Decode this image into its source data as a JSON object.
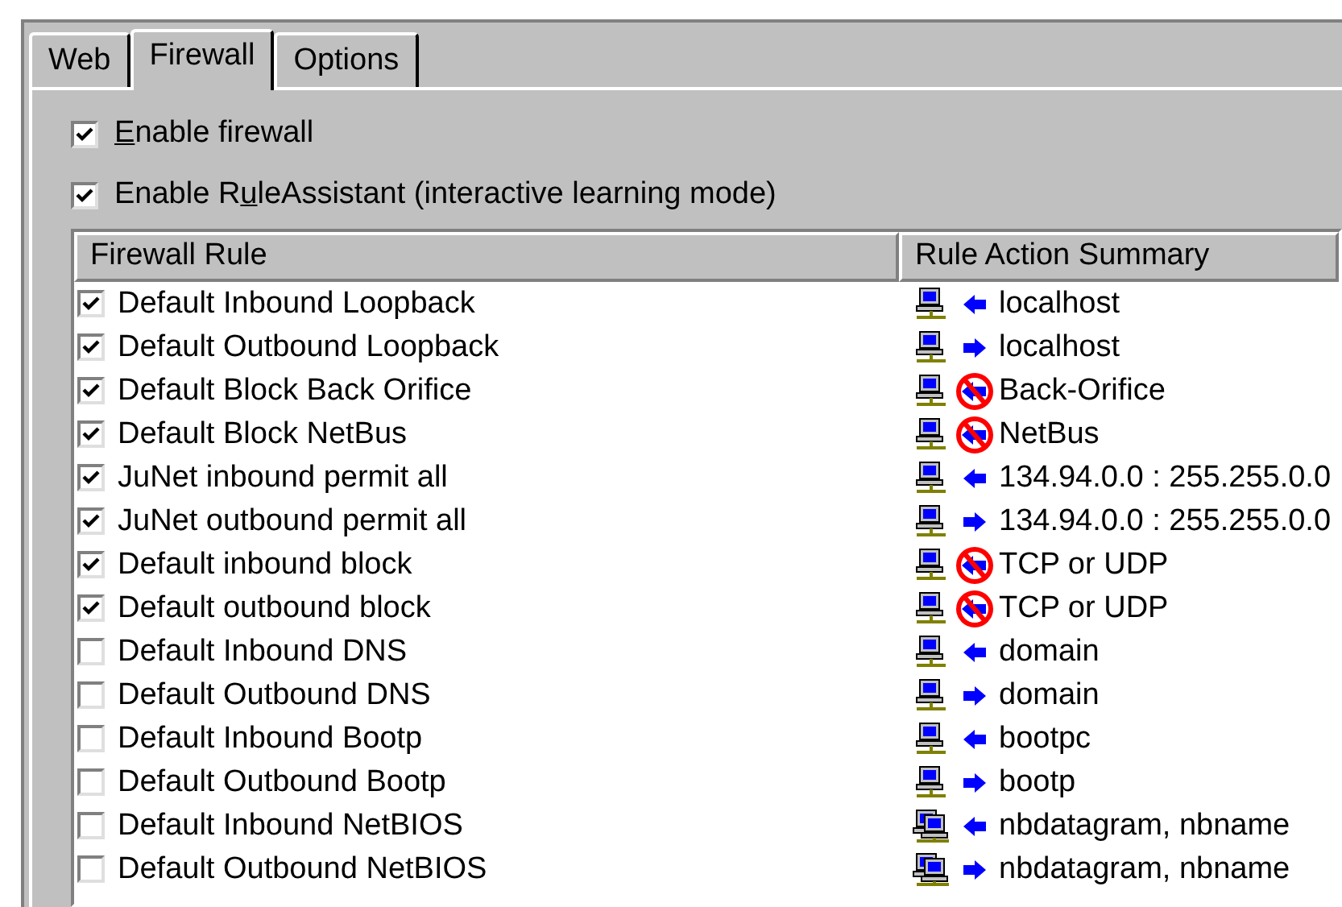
{
  "tabs": [
    {
      "label": "Web",
      "selected": false
    },
    {
      "label": "Firewall",
      "selected": true
    },
    {
      "label": "Options",
      "selected": false
    }
  ],
  "options": [
    {
      "key": "E",
      "after": "nable firewall",
      "checked": true
    },
    {
      "before": "Enable R",
      "key": "u",
      "after": "leAssistant (interactive learning mode)",
      "checked": true
    }
  ],
  "table": {
    "columns": [
      "Firewall Rule",
      "Rule Action Summary"
    ],
    "rows": [
      {
        "rule": "Default Inbound Loopback",
        "checked": true,
        "icons": [
          {
            "kind": "computer"
          },
          {
            "kind": "inbound"
          }
        ],
        "summary": "localhost"
      },
      {
        "rule": "Default Outbound Loopback",
        "checked": true,
        "icons": [
          {
            "kind": "computer"
          },
          {
            "kind": "outbound"
          }
        ],
        "summary": "localhost"
      },
      {
        "rule": "Default Block Back Orifice",
        "checked": true,
        "icons": [
          {
            "kind": "computer"
          },
          {
            "kind": "blocked"
          }
        ],
        "summary": "Back-Orifice"
      },
      {
        "rule": "Default Block NetBus",
        "checked": true,
        "icons": [
          {
            "kind": "computer"
          },
          {
            "kind": "blocked"
          }
        ],
        "summary": "NetBus"
      },
      {
        "rule": "JuNet inbound permit all",
        "checked": true,
        "icons": [
          {
            "kind": "computer"
          },
          {
            "kind": "inbound"
          }
        ],
        "summary": "134.94.0.0 : 255.255.0.0"
      },
      {
        "rule": "JuNet outbound permit all",
        "checked": true,
        "icons": [
          {
            "kind": "computer"
          },
          {
            "kind": "outbound"
          }
        ],
        "summary": "134.94.0.0 : 255.255.0.0"
      },
      {
        "rule": "Default inbound block",
        "checked": true,
        "icons": [
          {
            "kind": "computer"
          },
          {
            "kind": "blocked"
          }
        ],
        "summary": "TCP or UDP"
      },
      {
        "rule": "Default outbound block",
        "checked": true,
        "icons": [
          {
            "kind": "computer"
          },
          {
            "kind": "blocked"
          }
        ],
        "summary": "TCP or UDP"
      },
      {
        "rule": "Default Inbound DNS",
        "checked": false,
        "icons": [
          {
            "kind": "computer"
          },
          {
            "kind": "inbound"
          }
        ],
        "summary": "domain"
      },
      {
        "rule": "Default Outbound DNS",
        "checked": false,
        "icons": [
          {
            "kind": "computer"
          },
          {
            "kind": "outbound"
          }
        ],
        "summary": "domain"
      },
      {
        "rule": "Default Inbound Bootp",
        "checked": false,
        "icons": [
          {
            "kind": "computer"
          },
          {
            "kind": "inbound"
          }
        ],
        "summary": "bootpc"
      },
      {
        "rule": "Default Outbound Bootp",
        "checked": false,
        "icons": [
          {
            "kind": "computer"
          },
          {
            "kind": "outbound"
          }
        ],
        "summary": "bootp"
      },
      {
        "rule": "Default Inbound NetBIOS",
        "checked": false,
        "icons": [
          {
            "kind": "computers"
          },
          {
            "kind": "inbound"
          }
        ],
        "summary": "nbdatagram, nbname"
      },
      {
        "rule": "Default Outbound NetBIOS",
        "checked": false,
        "icons": [
          {
            "kind": "computers"
          },
          {
            "kind": "outbound"
          }
        ],
        "summary": "nbdatagram, nbname"
      }
    ]
  }
}
